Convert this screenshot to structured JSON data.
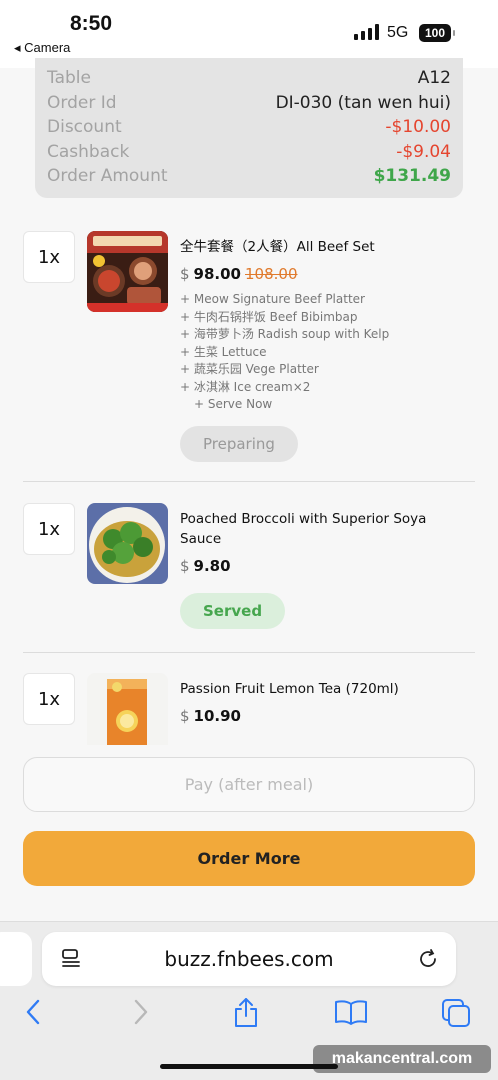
{
  "status_bar": {
    "time": "8:50",
    "back_label": "◂ Camera",
    "network": "5G",
    "battery": "100"
  },
  "summary": [
    {
      "label": "Table",
      "value": "A12",
      "tone": "normal"
    },
    {
      "label": "Order Id",
      "value": "DI-030 (tan wen hui)",
      "tone": "normal"
    },
    {
      "label": "Discount",
      "value": "-$10.00",
      "tone": "red"
    },
    {
      "label": "Cashback",
      "value": "-$9.04",
      "tone": "red"
    },
    {
      "label": "Order Amount",
      "value": "$131.49",
      "tone": "green"
    }
  ],
  "items": [
    {
      "qty": "1x",
      "name": "全牛套餐（2人餐）All Beef Set",
      "currency": "$",
      "price": "98.00",
      "old_price": "108.00",
      "options": [
        "+ Meow Signature Beef Platter",
        "+ 牛肉石锅拌饭 Beef Bibimbap",
        "+ 海带萝卜汤 Radish soup with Kelp",
        "+ 生菜 Lettuce",
        "+ 蔬菜乐园 Vege Platter",
        "+ 冰淇淋 Ice cream×2"
      ],
      "sub_option": "+ Serve Now",
      "status": "Preparing"
    },
    {
      "qty": "1x",
      "name": "Poached Broccoli with Superior Soya Sauce",
      "currency": "$",
      "price": "9.80",
      "status": "Served"
    },
    {
      "qty": "1x",
      "name": "Passion Fruit Lemon Tea (720ml)",
      "currency": "$",
      "price": "10.90"
    }
  ],
  "buttons": {
    "pay": "Pay (after meal)",
    "order_more": "Order More"
  },
  "browser": {
    "url": "buzz.fnbees.com"
  },
  "watermark": "makancentral.com",
  "colors": {
    "accent": "#f2a93a",
    "discount": "#e5452f",
    "total": "#3fa64a"
  }
}
